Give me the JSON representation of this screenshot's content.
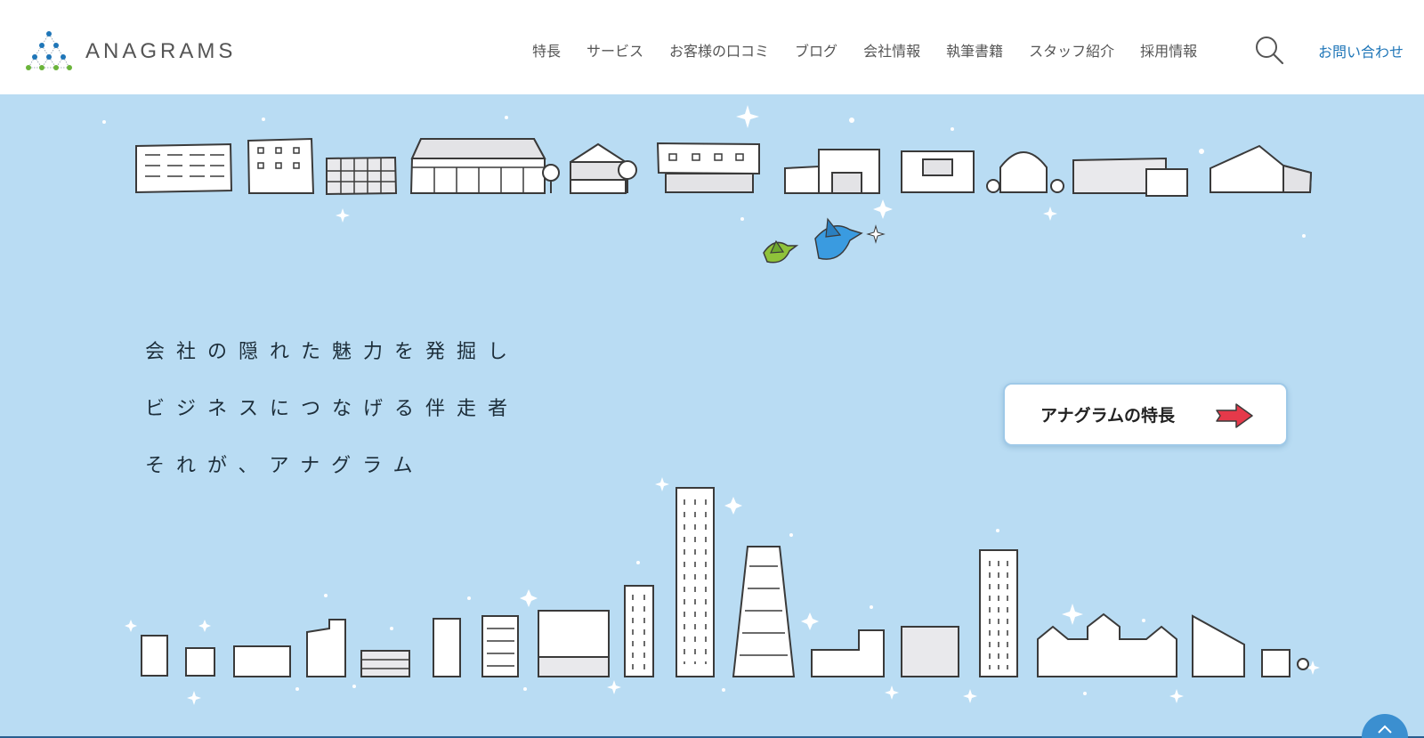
{
  "header": {
    "logo_text": "ANAGRAMS",
    "nav_items": [
      {
        "label": "特長"
      },
      {
        "label": "サービス"
      },
      {
        "label": "お客様の口コミ"
      },
      {
        "label": "ブログ"
      },
      {
        "label": "会社情報"
      },
      {
        "label": "執筆書籍"
      },
      {
        "label": "スタッフ紹介"
      },
      {
        "label": "採用情報"
      }
    ],
    "search_icon": "search-icon",
    "contact_label": "お問い合わせ"
  },
  "hero": {
    "tagline": [
      "会社の隠れた魅力を発掘し",
      "ビジネスにつなげる伴走者",
      "それが、アナグラム"
    ],
    "feature_button_label": "アナグラムの特長",
    "feature_button_icon": "arrow-right-icon",
    "background_color": "#b9dcf3"
  },
  "page_top_icon": "arrow-up-icon",
  "colors": {
    "accent_blue": "#1f76b8",
    "arrow_red": "#e5394a",
    "bird_blue": "#3a9be0",
    "bird_green": "#8fc23a"
  }
}
